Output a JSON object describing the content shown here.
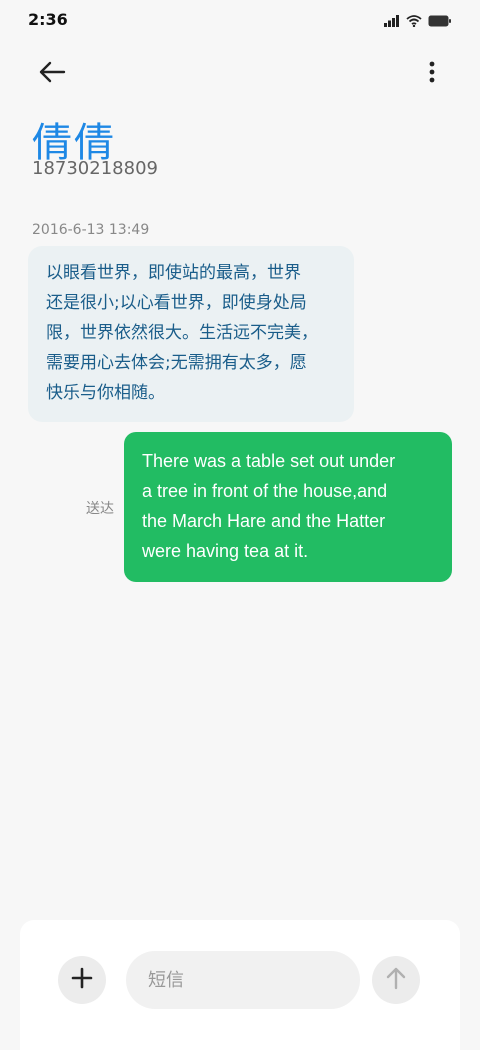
{
  "status_bar": {
    "time": "2:36",
    "icons": [
      "signal-icon",
      "wifi-icon",
      "battery-icon"
    ]
  },
  "app_bar": {
    "back_icon": "arrow-left-icon",
    "menu_icon": "more-vertical-icon"
  },
  "contact": {
    "name": "倩倩",
    "number": "18730218809"
  },
  "conversation": {
    "timestamp": "2016-6-13 13:49",
    "incoming": {
      "lines": [
        "以眼看世界，即使站的最高，世界",
        "还是很小;以心看世界，即使身处局",
        "限，世界依然很大。生活远不完美，",
        "需要用心去体会;无需拥有太多，愿",
        "快乐与你相随。"
      ]
    },
    "outgoing": {
      "lines": [
        "There was a table set out under",
        "a tree in front of the house,and",
        "the March Hare and the Hatter",
        "were having tea at it."
      ],
      "status": "送达"
    }
  },
  "composer": {
    "placeholder": "短信",
    "add_icon": "plus-icon",
    "send_icon": "arrow-up-icon"
  },
  "colors": {
    "contact_name": "#1e88e5",
    "incoming_bubble": "#ebf1f3",
    "incoming_text": "#1a5d8a",
    "outgoing_bubble": "#22bc63"
  }
}
